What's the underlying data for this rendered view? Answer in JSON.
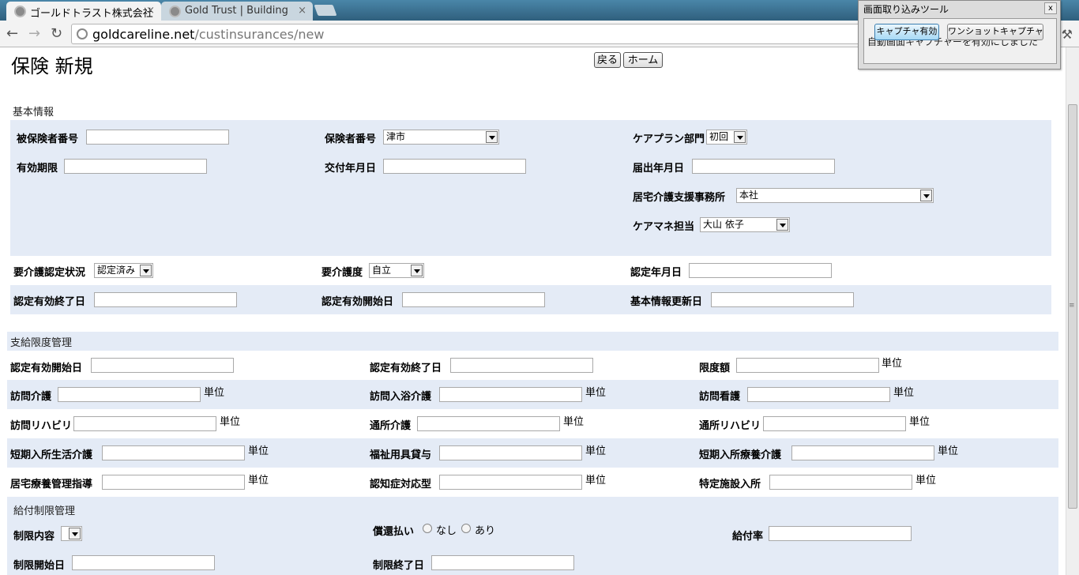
{
  "browser": {
    "tabs": [
      {
        "title": "ゴールドトラスト株式会社",
        "close": "×"
      },
      {
        "title": "Gold Trust | Building",
        "close": "×"
      }
    ],
    "url_host": "goldcareline.net",
    "url_path": "/custinsurances/new"
  },
  "capture_tool": {
    "title": "画面取り込みツール",
    "close": "x",
    "enable_button": "キャプチャ有効",
    "oneshot_button": "ワンショットキャプチャ",
    "message": "自動画面キャプチャーを有効にしました"
  },
  "page": {
    "title": "保険 新規",
    "back_button": "戻る",
    "home_button": "ホーム"
  },
  "basic_info": {
    "section": "基本情報",
    "insured_number_label": "被保険者番号",
    "insurer_number_label": "保険者番号",
    "insurer_number_value": "津市",
    "careplan_dept_label": "ケアプラン部門",
    "careplan_dept_value": "初回",
    "valid_until_label": "有効期限",
    "issue_date_label": "交付年月日",
    "filing_date_label": "届出年月日",
    "home_care_office_label": "居宅介護支援事務所",
    "home_care_office_value": "本社",
    "care_manager_label": "ケアマネ担当",
    "care_manager_value": "大山 依子",
    "certification_status_label": "要介護認定状況",
    "certification_status_value": "認定済み",
    "care_level_label": "要介護度",
    "care_level_value": "自立",
    "certification_date_label": "認定年月日",
    "cert_valid_end_label": "認定有効終了日",
    "cert_valid_start_label": "認定有効開始日",
    "basic_info_update_label": "基本情報更新日"
  },
  "payment_limit": {
    "section": "支給限度管理",
    "unit": "単位",
    "cert_start_label": "認定有効開始日",
    "cert_end_label": "認定有効終了日",
    "limit_amount_label": "限度額",
    "home_visit_care": "訪問介護",
    "home_visit_bath": "訪問入浴介護",
    "home_visit_nursing": "訪問看護",
    "home_visit_rehab": "訪問リハビリ",
    "day_care": "通所介護",
    "day_rehab": "通所リハビリ",
    "short_stay_life": "短期入所生活介護",
    "welfare_equipment": "福祉用具貸与",
    "short_stay_medical": "短期入所療養介護",
    "home_medical_guidance": "居宅療養管理指導",
    "dementia_care": "認知症対応型",
    "specified_facility": "特定施設入所"
  },
  "benefit_limit": {
    "section": "給付制限管理",
    "restriction_label": "制限内容",
    "reimbursement_label": "償還払い",
    "option_none": "なし",
    "option_yes": "あり",
    "benefit_rate_label": "給付率",
    "start_date_label": "制限開始日",
    "end_date_label": "制限終了日"
  }
}
